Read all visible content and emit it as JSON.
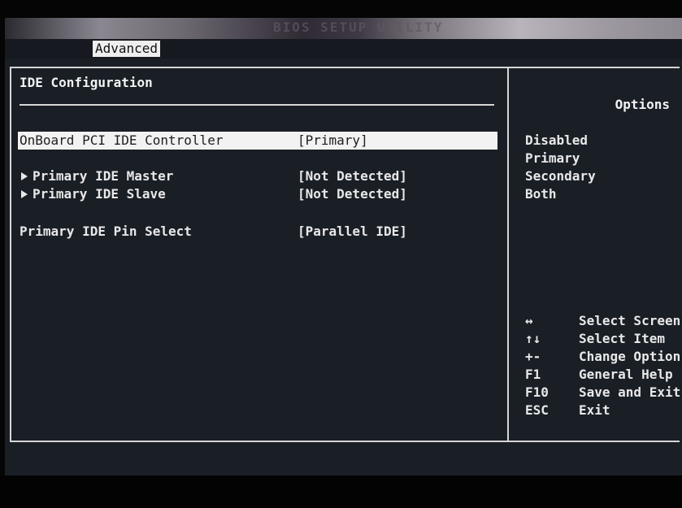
{
  "header": {
    "title": "BIOS SETUP UTILITY",
    "active_tab": "Advanced"
  },
  "main": {
    "section_title": "IDE Configuration",
    "items": [
      {
        "label": "OnBoard PCI IDE Controller",
        "value": "[Primary]",
        "selected": true,
        "submenu": false
      },
      {
        "label": "Primary IDE Master",
        "value": "[Not Detected]",
        "selected": false,
        "submenu": true
      },
      {
        "label": "Primary IDE Slave",
        "value": "[Not Detected]",
        "selected": false,
        "submenu": true
      },
      {
        "label": "Primary IDE Pin Select",
        "value": "[Parallel IDE]",
        "selected": false,
        "submenu": false
      }
    ]
  },
  "options_panel": {
    "title": "Options",
    "options": [
      "Disabled",
      "Primary",
      "Secondary",
      "Both"
    ]
  },
  "help": [
    {
      "key": "↔",
      "desc": "Select Screen"
    },
    {
      "key": "↑↓",
      "desc": "Select Item"
    },
    {
      "key": "+-",
      "desc": "Change Option"
    },
    {
      "key": "F1",
      "desc": "General Help"
    },
    {
      "key": "F10",
      "desc": "Save and Exit"
    },
    {
      "key": "ESC",
      "desc": "Exit"
    }
  ],
  "colors": {
    "background": "#1a1f26",
    "text": "#e8e8e8",
    "highlight": "#f2f2f2"
  }
}
